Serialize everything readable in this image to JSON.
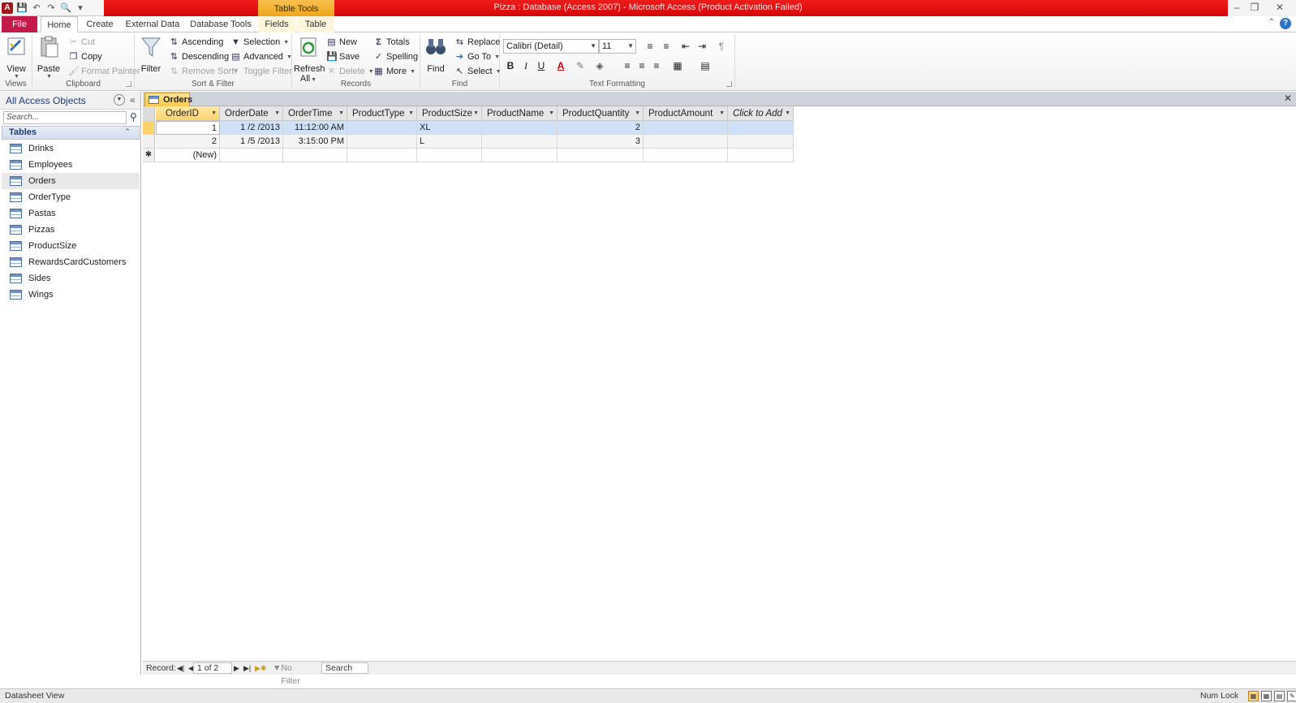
{
  "window": {
    "title": "Pizza : Database (Access 2007)  -  Microsoft Access (Product Activation Failed)",
    "context_tab_group": "Table Tools"
  },
  "ribbon_tabs": [
    "File",
    "Home",
    "Create",
    "External Data",
    "Database Tools",
    "Fields",
    "Table"
  ],
  "ribbon": {
    "views": {
      "label": "Views",
      "view": "View"
    },
    "clipboard": {
      "label": "Clipboard",
      "paste": "Paste",
      "cut": "Cut",
      "copy": "Copy",
      "format_painter": "Format Painter"
    },
    "sort_filter": {
      "label": "Sort & Filter",
      "filter": "Filter",
      "ascending": "Ascending",
      "descending": "Descending",
      "remove_sort": "Remove Sort",
      "selection": "Selection",
      "advanced": "Advanced",
      "toggle_filter": "Toggle Filter"
    },
    "records": {
      "label": "Records",
      "refresh": "Refresh",
      "refresh_sub": "All",
      "new": "New",
      "save": "Save",
      "delete": "Delete",
      "totals": "Totals",
      "spelling": "Spelling",
      "more": "More"
    },
    "find": {
      "label": "Find",
      "find": "Find",
      "replace": "Replace",
      "goto": "Go To",
      "select": "Select"
    },
    "text_formatting": {
      "label": "Text Formatting",
      "font": "Calibri (Detail)",
      "size": "11"
    }
  },
  "nav_pane": {
    "title": "All Access Objects",
    "search_placeholder": "Search...",
    "group": "Tables",
    "items": [
      "Drinks",
      "Employees",
      "Orders",
      "OrderType",
      "Pastas",
      "Pizzas",
      "ProductSize",
      "RewardsCardCustomers",
      "Sides",
      "Wings"
    ],
    "selected": "Orders"
  },
  "document": {
    "tab": "Orders",
    "columns": [
      "OrderID",
      "OrderDate",
      "OrderTime",
      "ProductType",
      "ProductSize",
      "ProductName",
      "ProductQuantity",
      "ProductAmount",
      "Click to Add"
    ],
    "rows": [
      [
        "1",
        "1 /2 /2013",
        "11:12:00 AM",
        "",
        "XL",
        "",
        "2",
        ""
      ],
      [
        "2",
        "1 /5 /2013",
        "3:15:00 PM",
        "",
        "L",
        "",
        "3",
        ""
      ]
    ],
    "new_row": "(New)",
    "new_row_marker": "✱"
  },
  "record_bar": {
    "label": "Record:",
    "position": "1 of 2",
    "filter": "No Filter",
    "search": "Search"
  },
  "status": {
    "view": "Datasheet View",
    "num_lock": "Num Lock"
  }
}
